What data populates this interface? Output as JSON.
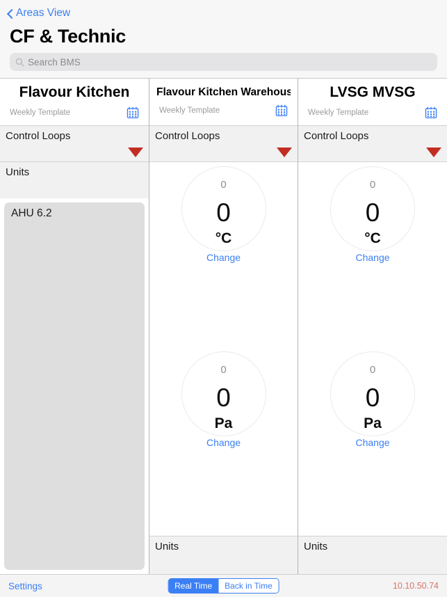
{
  "nav": {
    "back_label": "Areas View",
    "back_icon": "chevron-left-icon",
    "title": "CF & Technic"
  },
  "search": {
    "placeholder": "Search BMS",
    "value": "",
    "icon": "search-icon"
  },
  "columns": [
    {
      "title": "Flavour Kitchen",
      "subtitle": "Weekly Template",
      "calendar_icon": "calendar-icon",
      "sections": [
        {
          "label": "Control Loops",
          "collapsed": true,
          "marker": "triangle-down-icon"
        },
        {
          "label": "Units",
          "collapsed": false,
          "marker": ""
        }
      ],
      "units": [
        {
          "label": "AHU 6.2"
        }
      ],
      "gauges": []
    },
    {
      "title": "Flavour Kitchen Warehouse",
      "subtitle": "Weekly Template",
      "calendar_icon": "calendar-icon",
      "sections": [
        {
          "label": "Control Loops",
          "collapsed": false,
          "marker": "triangle-down-icon"
        }
      ],
      "footer_section": "Units",
      "gauges": [
        {
          "setpoint": "0",
          "value": "0",
          "unit": "°C",
          "action": "Change"
        },
        {
          "setpoint": "0",
          "value": "0",
          "unit": "Pa",
          "action": "Change"
        }
      ]
    },
    {
      "title": "LVSG MVSG",
      "subtitle": "Weekly Template",
      "calendar_icon": "calendar-icon",
      "sections": [
        {
          "label": "Control Loops",
          "collapsed": false,
          "marker": "triangle-down-icon"
        }
      ],
      "footer_section": "Units",
      "gauges": [
        {
          "setpoint": "0",
          "value": "0",
          "unit": "°C",
          "action": "Change"
        },
        {
          "setpoint": "0",
          "value": "0",
          "unit": "Pa",
          "action": "Change"
        }
      ]
    }
  ],
  "toolbar": {
    "settings_label": "Settings",
    "segments": [
      {
        "label": "Real Time",
        "selected": true
      },
      {
        "label": "Back in Time",
        "selected": false
      }
    ],
    "ip_address": "10.10.50.74"
  },
  "colors": {
    "accent_blue": "#3b7ff4",
    "marker_red": "#c22d22",
    "ip_red": "#d9736a",
    "section_gray": "#f1f1f1",
    "tile_gray": "#dedede"
  }
}
